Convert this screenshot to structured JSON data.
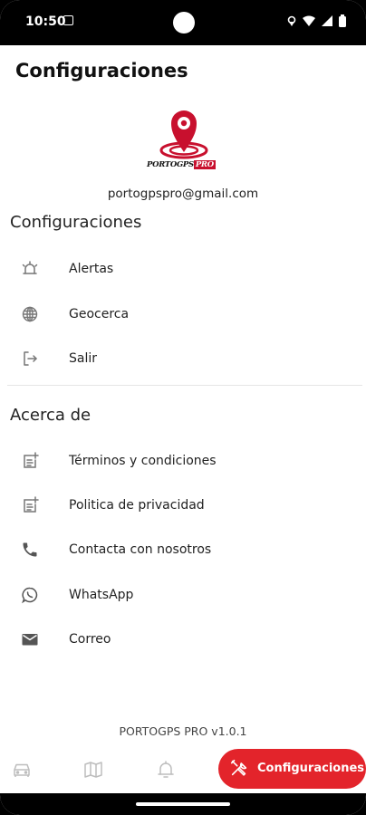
{
  "status_bar": {
    "time": "10:50"
  },
  "header": {
    "title": "Configuraciones"
  },
  "profile": {
    "logo_text": "PORTOGPS",
    "logo_badge": "PRO",
    "email": "portogpspro@gmail.com"
  },
  "settings_section": {
    "title": "Configuraciones",
    "items": [
      {
        "label": "Alertas",
        "icon": "alarm-icon"
      },
      {
        "label": "Geocerca",
        "icon": "globe-grid-icon"
      },
      {
        "label": "Salir",
        "icon": "logout-icon"
      }
    ]
  },
  "about_section": {
    "title": "Acerca de",
    "items": [
      {
        "label": "Términos y condiciones",
        "icon": "document-add-icon"
      },
      {
        "label": "Politica de privacidad",
        "icon": "document-add-icon"
      },
      {
        "label": "Contacta con nosotros",
        "icon": "phone-icon"
      },
      {
        "label": "WhatsApp",
        "icon": "whatsapp-icon"
      },
      {
        "label": "Correo",
        "icon": "mail-icon"
      }
    ]
  },
  "version": "PORTOGPS PRO v1.0.1",
  "bottom_nav": {
    "items": [
      {
        "icon": "car-icon"
      },
      {
        "icon": "map-icon"
      },
      {
        "icon": "bell-icon"
      }
    ],
    "active": {
      "label": "Configuraciones",
      "icon": "tools-icon"
    }
  },
  "colors": {
    "accent": "#e3242b",
    "brand_red": "#c8102e",
    "text": "#222222"
  }
}
